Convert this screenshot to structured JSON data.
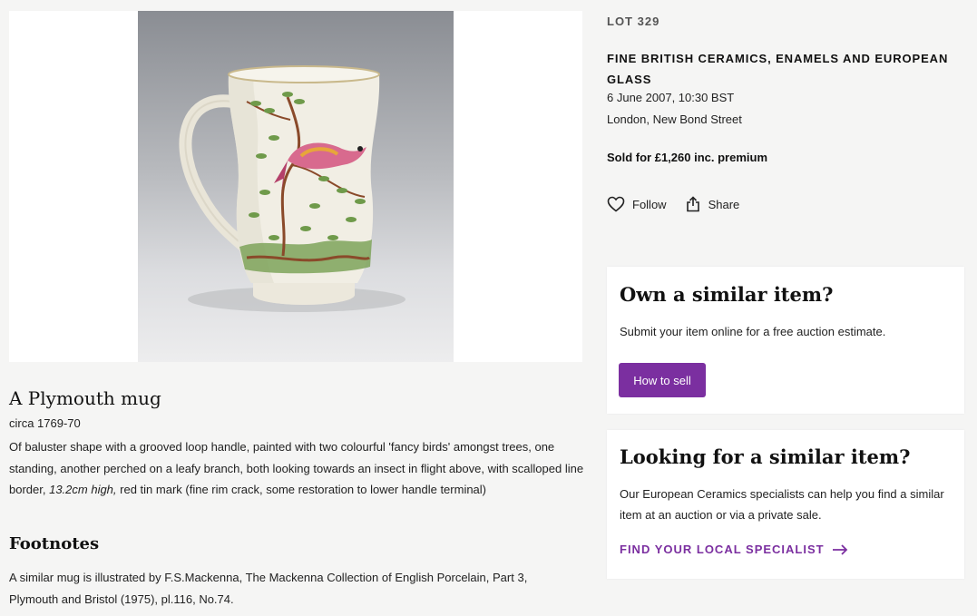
{
  "lot": {
    "number": "LOT 329",
    "title": "A Plymouth mug",
    "date": "circa 1769-70",
    "description_before": "Of baluster shape with a grooved loop handle, painted with two colourful 'fancy birds' amongst trees, one standing, another perched on a leafy branch, both looking towards an insect in flight above, with scalloped line border, ",
    "description_italic": "13.2cm high,",
    "description_after": " red tin mark (fine rim crack, some restoration to lower handle terminal)",
    "footnotes_heading": "Footnotes",
    "footnote": "A similar mug is illustrated by F.S.Mackenna, The Mackenna Collection of English Porcelain, Part 3, Plymouth and Bristol (1975), pl.116, No.74."
  },
  "sale": {
    "title": "FINE BRITISH CERAMICS, ENAMELS AND EUROPEAN GLASS",
    "date": "6 June 2007, 10:30 BST",
    "location": "London, New Bond Street",
    "sold": "Sold for £1,260 inc. premium"
  },
  "actions": {
    "follow_label": "Follow",
    "follow_icon": "heart-icon",
    "share_label": "Share",
    "share_icon": "share-icon"
  },
  "own_card": {
    "title": "Own a similar item?",
    "text": "Submit your item online for a free auction estimate.",
    "button_label": "How to sell"
  },
  "look_card": {
    "title": "Looking for a similar item?",
    "text": "Our European Ceramics specialists can help you find a similar item at an auction or via a private sale.",
    "link_label": "FIND YOUR LOCAL SPECIALIST",
    "link_icon": "arrow-right-icon"
  },
  "colors": {
    "accent": "#7b2fa0",
    "page_background": "#f5f5f4",
    "card_background": "#ffffff"
  }
}
